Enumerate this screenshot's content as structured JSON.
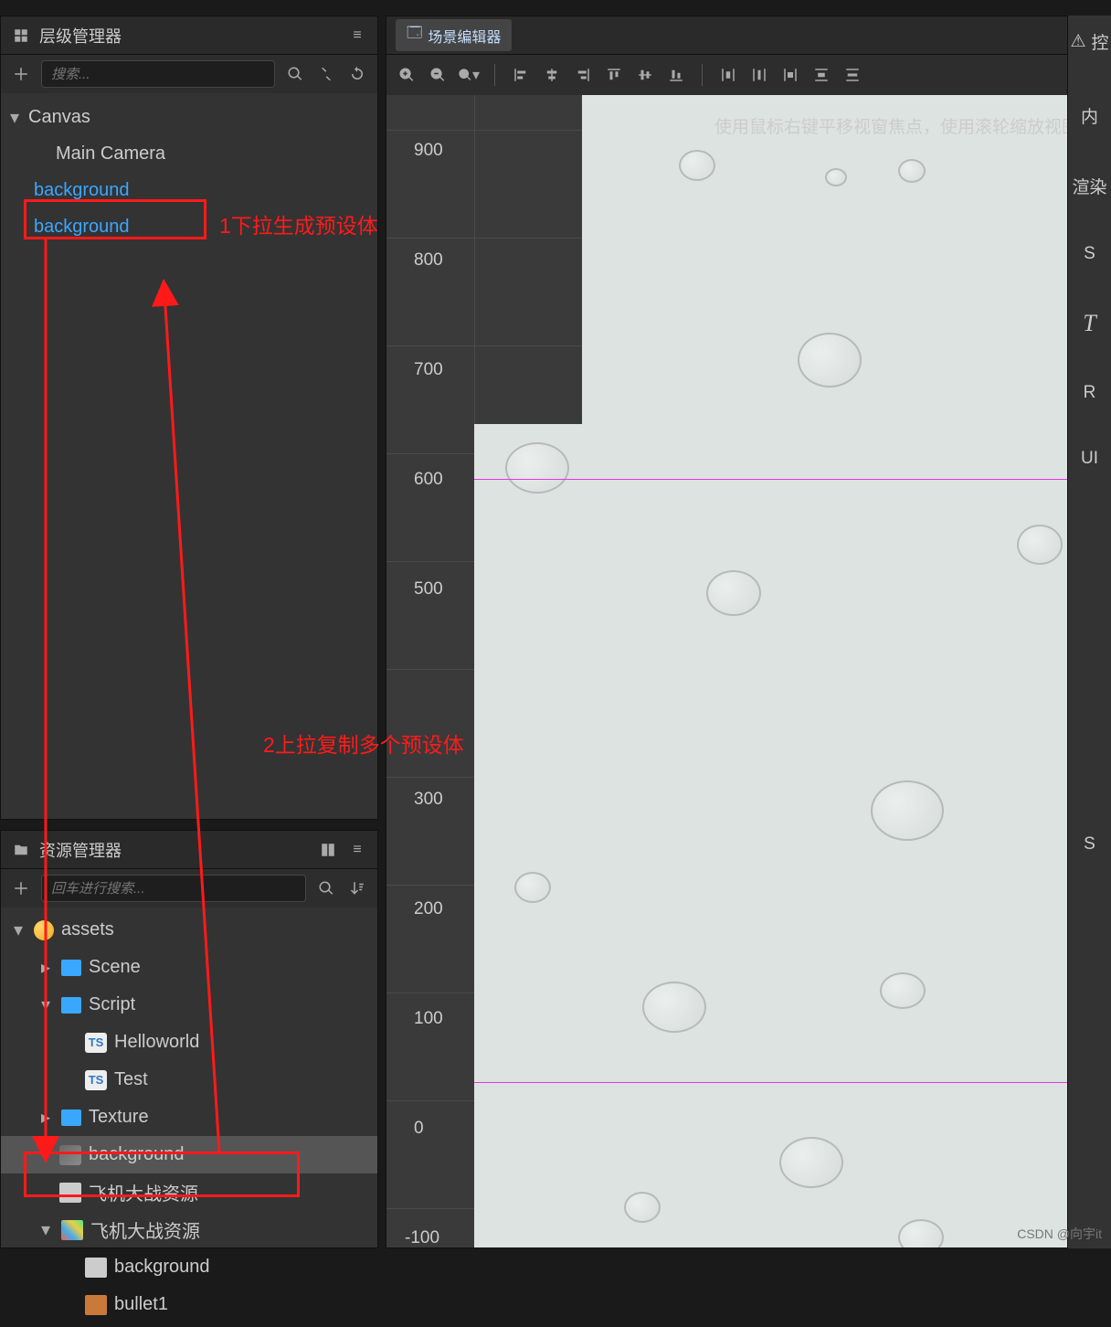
{
  "hierarchy": {
    "title": "层级管理器",
    "search_placeholder": "搜索...",
    "root": {
      "label": "Canvas"
    },
    "camera": {
      "label": "Main Camera"
    },
    "bg1": {
      "label": "background"
    },
    "bg2": {
      "label": "background"
    }
  },
  "assets": {
    "title": "资源管理器",
    "search_placeholder": "回车进行搜索...",
    "root": "assets",
    "scene": "Scene",
    "script": "Script",
    "helloworld": "Helloworld",
    "test": "Test",
    "texture": "Texture",
    "background": "background",
    "pack1": "飞机大战资源",
    "pack2": "飞机大战资源",
    "img_background": "background",
    "img_bullet1": "bullet1",
    "ts_badge": "TS"
  },
  "scene": {
    "tab_title": "场景编辑器",
    "hint": "使用鼠标右键平移视窗焦点，使用滚轮缩放视图",
    "ticks": {
      "t900": "900",
      "t800": "800",
      "t700": "700",
      "t600": "600",
      "t500": "500",
      "t300": "300",
      "t200": "200",
      "t100": "100",
      "t0": "0",
      "tn100": "-100"
    }
  },
  "rightstrip": {
    "title": "控",
    "items": {
      "a": "内",
      "b": "渲染",
      "c": "S",
      "d": "T",
      "e": "R",
      "f": "UI",
      "g": "S"
    }
  },
  "annotations": {
    "a1": "1下拉生成预设体",
    "a2": "2上拉复制多个预设体"
  },
  "watermark": "CSDN @向宇it"
}
